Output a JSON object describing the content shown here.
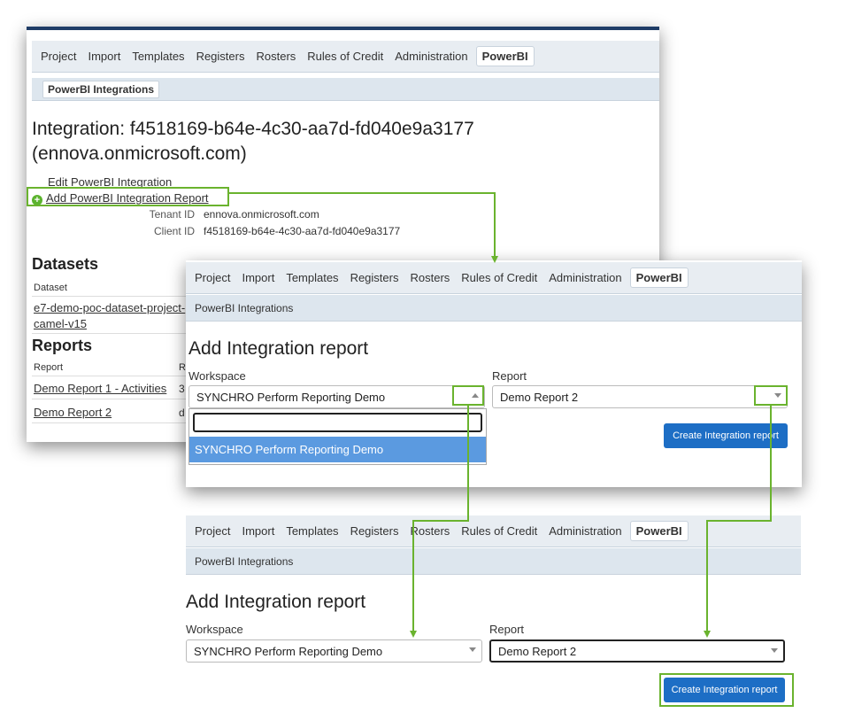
{
  "nav": {
    "items": [
      "Project",
      "Import",
      "Templates",
      "Registers",
      "Rosters",
      "Rules of Credit",
      "Administration"
    ],
    "active": "PowerBI"
  },
  "subnav": {
    "label": "PowerBI Integrations"
  },
  "integration": {
    "heading_line1": "Integration: f4518169-b64e-4c30-aa7d-fd040e9a3177",
    "heading_line2": "(ennova.onmicrosoft.com)",
    "edit_link": "Edit PowerBI Integration",
    "add_link": "Add PowerBI Integration Report",
    "tenant_label": "Tenant ID",
    "tenant_value": "ennova.onmicrosoft.com",
    "client_label": "Client ID",
    "client_value": "f4518169-b64e-4c30-aa7d-fd040e9a3177"
  },
  "datasets": {
    "title": "Datasets",
    "column": "Dataset",
    "row_line1": "e7-demo-poc-dataset-project-",
    "row_line2": "camel-v15"
  },
  "reports": {
    "title": "Reports",
    "col1": "Report",
    "col2": "R",
    "rows": [
      {
        "name": "Demo Report 1 - Activities",
        "extra": "3"
      },
      {
        "name": "Demo Report 2",
        "extra": "d"
      }
    ]
  },
  "add_report": {
    "title": "Add Integration report",
    "workspace_label": "Workspace",
    "workspace_value": "SYNCHRO Perform Reporting Demo",
    "report_label": "Report",
    "report_value": "Demo Report 2",
    "dropdown_option": "SYNCHRO Perform Reporting Demo",
    "create_button": "Create Integration report"
  },
  "colors": {
    "highlight": "#6ab32e",
    "primary_button": "#1d6ec5",
    "dropdown_selected": "#5b9ae0"
  }
}
